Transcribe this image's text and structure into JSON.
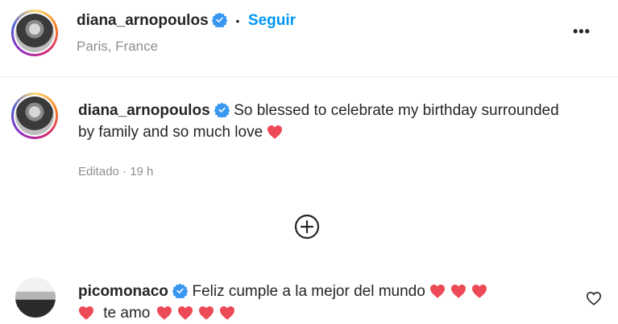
{
  "header": {
    "username": "diana_arnopoulos",
    "separator": "•",
    "follow_label": "Seguir",
    "location": "Paris, France",
    "more_label": "•••"
  },
  "caption": {
    "username": "diana_arnopoulos",
    "text": "So blessed to celebrate my birthday surrounded by family and so much love",
    "hearts": 1,
    "meta": "Editado · 19 h"
  },
  "load_more_label": "⊕",
  "comment": {
    "username": "picomonaco",
    "text_part1": "Feliz cumple a la mejor del mundo",
    "hearts_part1": 3,
    "text_part2": "te amo",
    "hearts_part2": 4
  },
  "colors": {
    "verified": "#3897f0",
    "link": "#0095f6",
    "heart": "#ed4956",
    "muted": "#8e8e8e"
  }
}
